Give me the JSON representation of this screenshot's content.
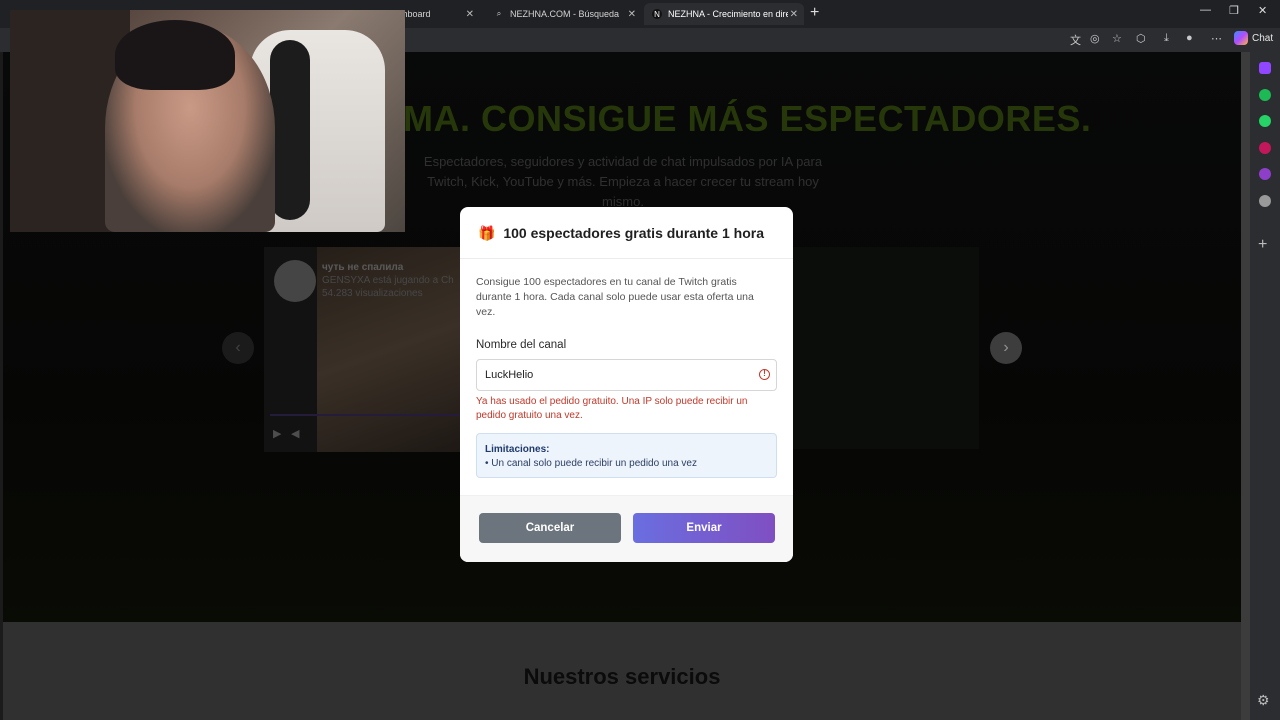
{
  "browser": {
    "tabs": [
      {
        "title": "shboard"
      },
      {
        "title": "NEZHNA.COM - Búsqueda"
      },
      {
        "title": "NEZHNA - Crecimiento en directo"
      }
    ],
    "new_tab": "+",
    "chat_label": "Chat"
  },
  "hero": {
    "title": "MA. CONSIGUE MÁS ESPECTADORES.",
    "subtitle": "Espectadores, seguidores y actividad de chat impulsados por IA para Twitch, Kick, YouTube y más. Empieza a hacer crecer tu stream hoy mismo."
  },
  "carousel": {
    "video_title": "чуть не спалила",
    "channel_line": "GENSYXA está jugando a Ch",
    "views": "54.283 visualizaciones"
  },
  "services": {
    "title": "Nuestros servicios"
  },
  "modal": {
    "title": "100 espectadores gratis durante 1 hora",
    "description": "Consigue 100 espectadores en tu canal de Twitch gratis durante 1 hora. Cada canal solo puede usar esta oferta una vez.",
    "field_label": "Nombre del canal",
    "field_value": "LuckHelio",
    "error": "Ya has usado el pedido gratuito. Una IP solo puede recibir un pedido gratuito una vez.",
    "limits_title": "Limitaciones:",
    "limits_item": "• Un canal solo puede recibir un pedido una vez",
    "cancel_label": "Cancelar",
    "send_label": "Enviar"
  },
  "colors": {
    "accent_green": "#3b5510",
    "send_gradient_start": "#6a6ee0",
    "send_gradient_end": "#7f4fc2",
    "cancel": "#6c757d",
    "error": "#c0392b"
  },
  "icons": [
    "gift-icon",
    "error-icon",
    "play-icon",
    "volume-icon",
    "chevron-left-icon",
    "chevron-right-icon",
    "settings-icon",
    "plus-icon"
  ]
}
